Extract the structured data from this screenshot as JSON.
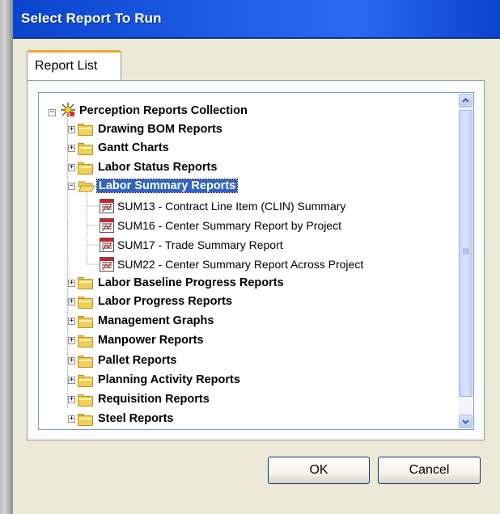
{
  "window": {
    "title": "Select Report To Run"
  },
  "tabs": [
    {
      "label": "Report List",
      "active": true
    }
  ],
  "tree": {
    "root": {
      "label": "Perception Reports Collection",
      "expanded": true,
      "icon": "collection-icon"
    },
    "folders": [
      {
        "label": "Drawing BOM Reports",
        "expanded": false
      },
      {
        "label": "Gantt Charts",
        "expanded": false
      },
      {
        "label": "Labor  Status Reports",
        "expanded": false
      },
      {
        "label": "Labor  Summary Reports",
        "expanded": true,
        "selected": true,
        "children": [
          {
            "label": "SUM13 - Contract Line Item (CLIN) Summary"
          },
          {
            "label": "SUM16 - Center Summary Report by Project"
          },
          {
            "label": "SUM17 - Trade Summary Report"
          },
          {
            "label": "SUM22 - Center Summary Report Across Project"
          }
        ]
      },
      {
        "label": "Labor Baseline Progress Reports",
        "expanded": false
      },
      {
        "label": "Labor Progress Reports",
        "expanded": false
      },
      {
        "label": "Management Graphs",
        "expanded": false
      },
      {
        "label": "Manpower Reports",
        "expanded": false
      },
      {
        "label": "Pallet Reports",
        "expanded": false
      },
      {
        "label": "Planning Activity Reports",
        "expanded": false
      },
      {
        "label": "Requisition Reports",
        "expanded": false
      },
      {
        "label": "Steel Reports",
        "expanded": false
      }
    ]
  },
  "buttons": {
    "ok": "OK",
    "cancel": "Cancel"
  },
  "colors": {
    "titlebar": "#0a44cc",
    "selection": "#3163c5",
    "tab_accent": "#f2a22a",
    "dialog_bg": "#ece9d8"
  }
}
